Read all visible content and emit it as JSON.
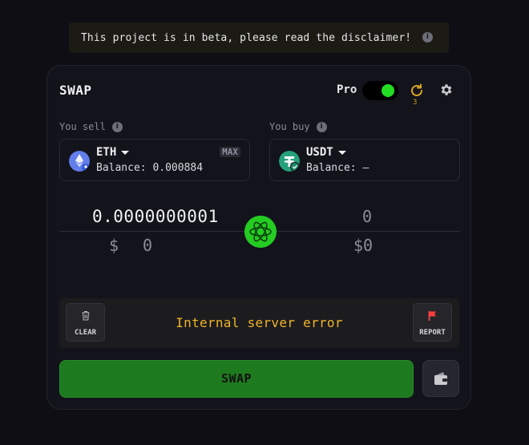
{
  "banner": {
    "text": "This project is in beta, please read the disclaimer!",
    "icon": "info-icon"
  },
  "header": {
    "title": "SWAP",
    "pro_label": "Pro",
    "pro_enabled": true,
    "refresh_count": "3",
    "accent_green": "#22dd22"
  },
  "sell": {
    "label": "You sell",
    "token": "ETH",
    "balance": "Balance: 0.000884",
    "max_label": "MAX",
    "amount": "0.0000000001",
    "usd_symbol": "$",
    "usd_value": "0"
  },
  "buy": {
    "label": "You buy",
    "token": "USDT",
    "balance": "Balance: —",
    "amount": "0",
    "usd_value": "$0"
  },
  "status": {
    "error": "Internal server error",
    "clear_label": "CLEAR",
    "report_label": "REPORT",
    "error_color": "#f0b429"
  },
  "actions": {
    "swap_label": "SWAP"
  }
}
